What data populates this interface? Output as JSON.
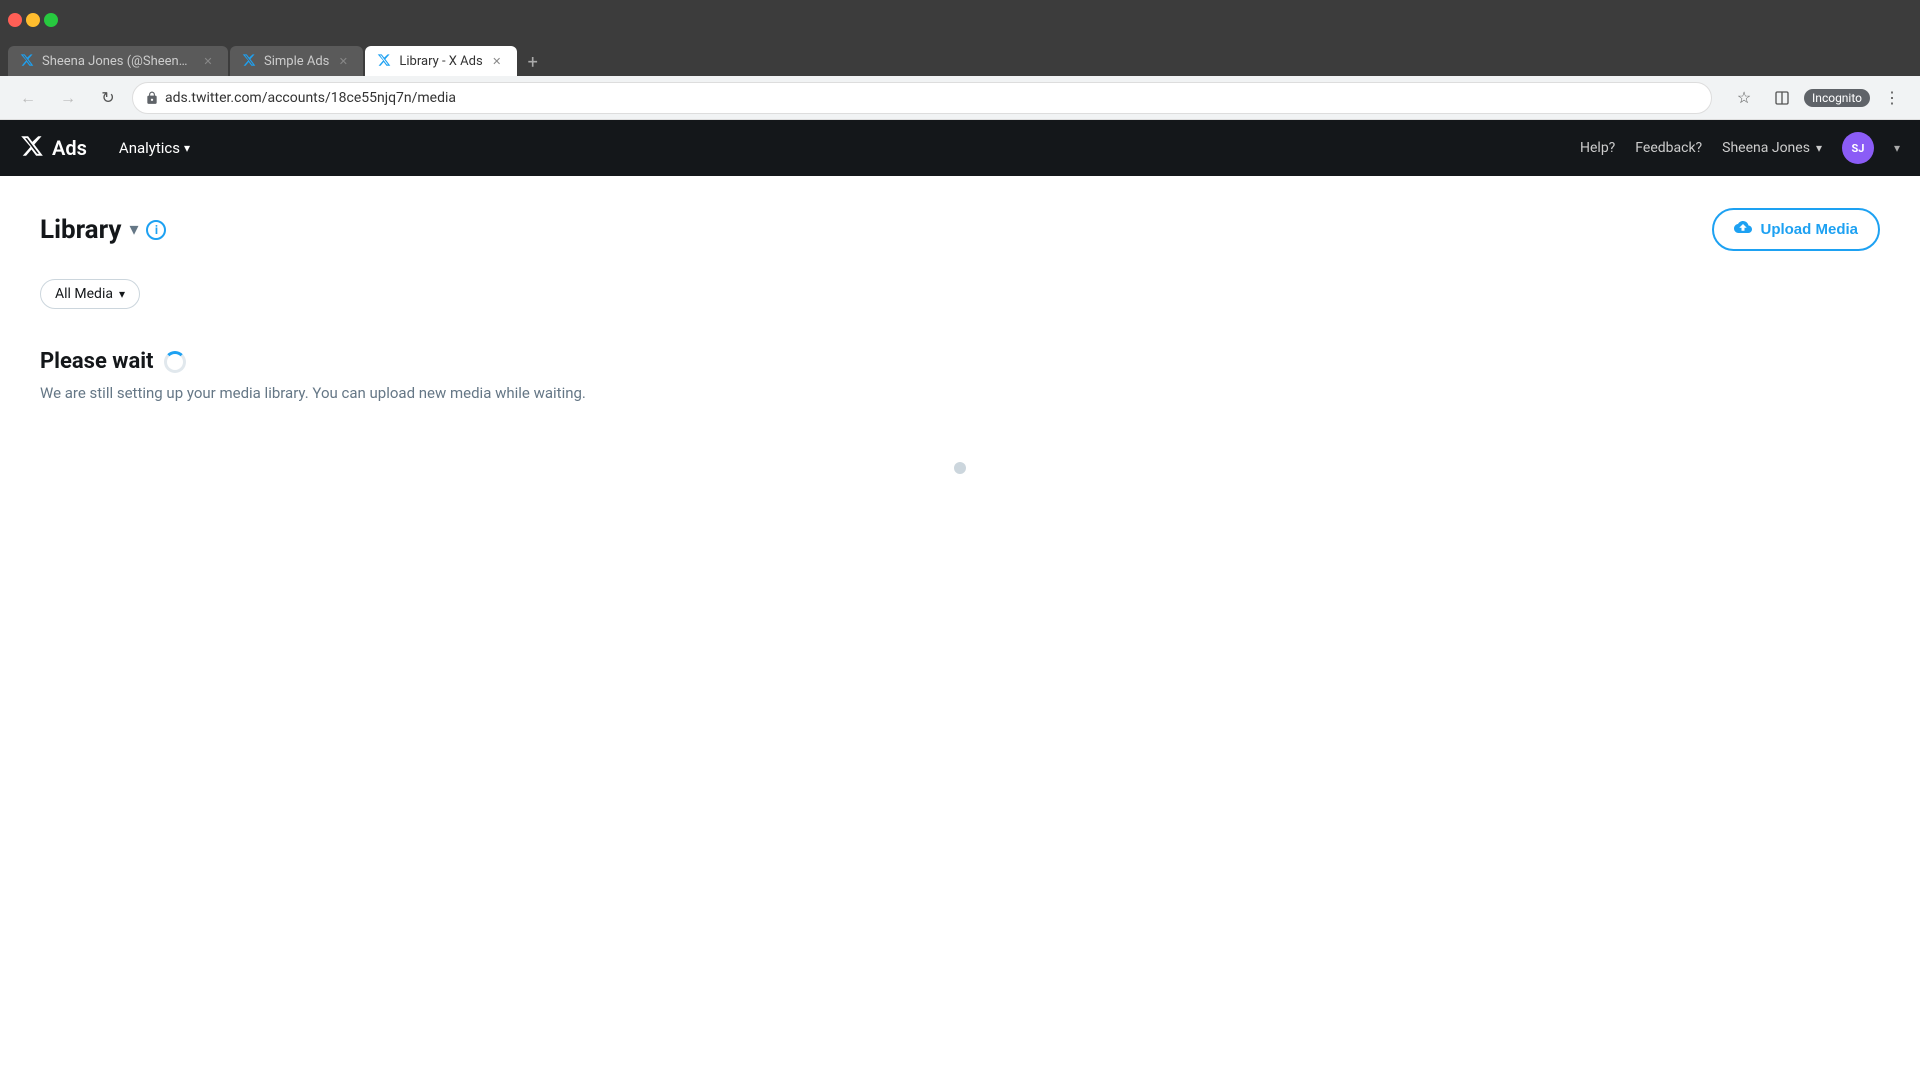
{
  "browser": {
    "tabs": [
      {
        "id": "tab1",
        "title": "Sheena Jones (@SheenaJone49...",
        "favicon": "X",
        "active": false,
        "favicon_color": "#000"
      },
      {
        "id": "tab2",
        "title": "Simple Ads",
        "favicon": "X",
        "active": false,
        "favicon_color": "#000"
      },
      {
        "id": "tab3",
        "title": "Library - X Ads",
        "favicon": "X",
        "active": true,
        "favicon_color": "#000"
      }
    ],
    "address": "ads.twitter.com/accounts/18ce55njq7n/media",
    "incognito_label": "Incognito"
  },
  "app": {
    "logo": {
      "bird": "🐦",
      "ads_label": "Ads"
    },
    "nav": {
      "analytics_label": "Analytics",
      "help_label": "Help?",
      "feedback_label": "Feedback?",
      "user_label": "Sheena Jones",
      "user_initials": "SJ"
    },
    "page": {
      "title": "Library",
      "upload_button": "Upload Media",
      "filter_label": "All Media",
      "please_wait_title": "Please wait",
      "please_wait_text": "We are still setting up your media library. You can upload new media while waiting."
    }
  }
}
